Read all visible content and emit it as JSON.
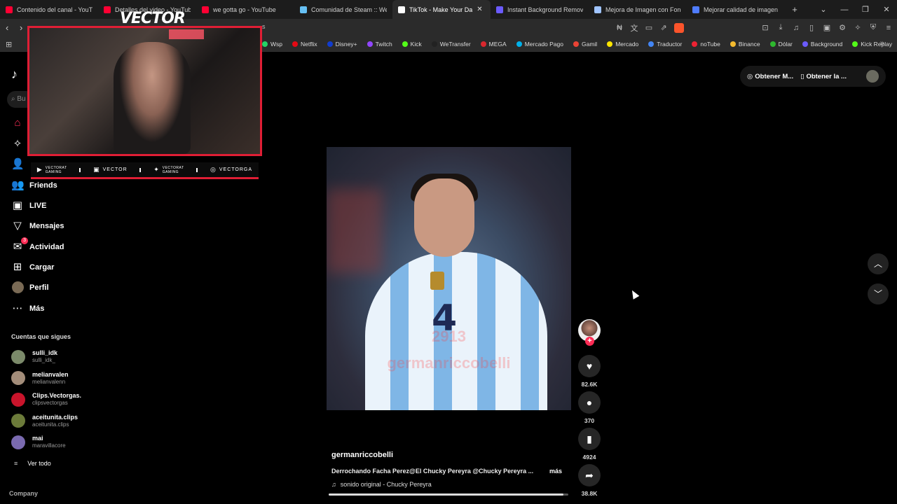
{
  "browser": {
    "tabs": [
      {
        "title": "Contenido del canal - YouTube",
        "color": "#ff0033",
        "active": false
      },
      {
        "title": "Detalles del video - YouTube S",
        "color": "#ff0033",
        "active": false
      },
      {
        "title": "we gotta go - YouTube",
        "color": "#ff0033",
        "active": false
      },
      {
        "title": "Comunidad de Steam :: We G",
        "color": "#66c0f4",
        "active": false
      },
      {
        "title": "TikTok - Make Your Da",
        "color": "#ffffff",
        "active": true
      },
      {
        "title": "Instant Background Remover",
        "color": "#6b5bff",
        "active": false
      },
      {
        "title": "Mejora de Imagen con Fondo",
        "color": "#a0c4ff",
        "active": false
      },
      {
        "title": "Mejorar calidad de imagen on",
        "color": "#4f7cff",
        "active": false
      }
    ],
    "new_tab": "+",
    "address_fragment": "s",
    "bookmarks": [
      {
        "label": "Wsp",
        "color": "#25d366"
      },
      {
        "label": "Netflix",
        "color": "#e50914"
      },
      {
        "label": "Disney+",
        "color": "#113ccf"
      },
      {
        "label": "Twitch",
        "color": "#9146ff"
      },
      {
        "label": "Kick",
        "color": "#53fc18"
      },
      {
        "label": "WeTransfer",
        "color": "#222222"
      },
      {
        "label": "MEGA",
        "color": "#d9272e"
      },
      {
        "label": "Mercado Pago",
        "color": "#00b1ea"
      },
      {
        "label": "Gamil",
        "color": "#ea4335"
      },
      {
        "label": "Mercado",
        "color": "#ffe600"
      },
      {
        "label": "Traductor",
        "color": "#4285f4"
      },
      {
        "label": "noTube",
        "color": "#e23"
      },
      {
        "label": "Binance",
        "color": "#f3ba2f"
      },
      {
        "label": "Dólar",
        "color": "#2eb82e"
      },
      {
        "label": "Background",
        "color": "#6b5bff"
      },
      {
        "label": "Kick Replay",
        "color": "#53fc18"
      }
    ]
  },
  "overlay": {
    "brand": "VECTOR",
    "socials": [
      {
        "icon": "▶",
        "top": "VECTORAT",
        "bottom": "GAMING",
        "label": ""
      },
      {
        "icon": "▣",
        "top": "",
        "bottom": "",
        "label": "VECTOR"
      },
      {
        "icon": "✦",
        "top": "VECTORAT",
        "bottom": "GAMING",
        "label": ""
      },
      {
        "icon": "◎",
        "top": "",
        "bottom": "",
        "label": "VECTORGA"
      }
    ]
  },
  "sidebar": {
    "search_placeholder": "Bu",
    "items": [
      {
        "label": "",
        "icon": "⌂"
      },
      {
        "label": "",
        "icon": "✧"
      },
      {
        "label": "",
        "icon": "👤"
      },
      {
        "label": "Friends",
        "icon": "👥"
      },
      {
        "label": "LIVE",
        "icon": "▣"
      },
      {
        "label": "Mensajes",
        "icon": "▽"
      },
      {
        "label": "Actividad",
        "icon": "✉",
        "badge": "3"
      },
      {
        "label": "Cargar",
        "icon": "⊞"
      },
      {
        "label": "Perfil",
        "icon": ""
      },
      {
        "label": "Más",
        "icon": "⋯"
      }
    ],
    "following_title": "Cuentas que sigues",
    "accounts": [
      {
        "name": "sulli_idk",
        "handle": "sulli_idk_",
        "color": "#7b8a6a"
      },
      {
        "name": "melianvalen",
        "handle": "melianvalenn",
        "color": "#a38d7a"
      },
      {
        "name": "Clips.Vectorgas.",
        "handle": "clipsvectorgas",
        "color": "#c9142b"
      },
      {
        "name": "aceitunita.clips",
        "handle": "aceitunita.clips",
        "color": "#6c7b3a"
      },
      {
        "name": "mai",
        "handle": "maravillacore",
        "color": "#7a6ab0"
      }
    ],
    "see_all": "Ver todo",
    "company": "Company"
  },
  "top_actions": {
    "get_coins": "Obtener M...",
    "get_app": "Obtener la ..."
  },
  "video": {
    "jersey_number": "4",
    "watermark_year": "2913",
    "watermark_handle": "germanriccobelli",
    "author": "germanriccobelli",
    "description": "Derrochando Facha Perez@El Chucky Pereyra @Chucky Pereyra ...",
    "more": "más",
    "sound": "sonido original - Chucky Pereyra",
    "progress": 0.98
  },
  "actions": {
    "likes": "82.6K",
    "comments": "370",
    "saves": "4924",
    "shares": "38.8K"
  }
}
